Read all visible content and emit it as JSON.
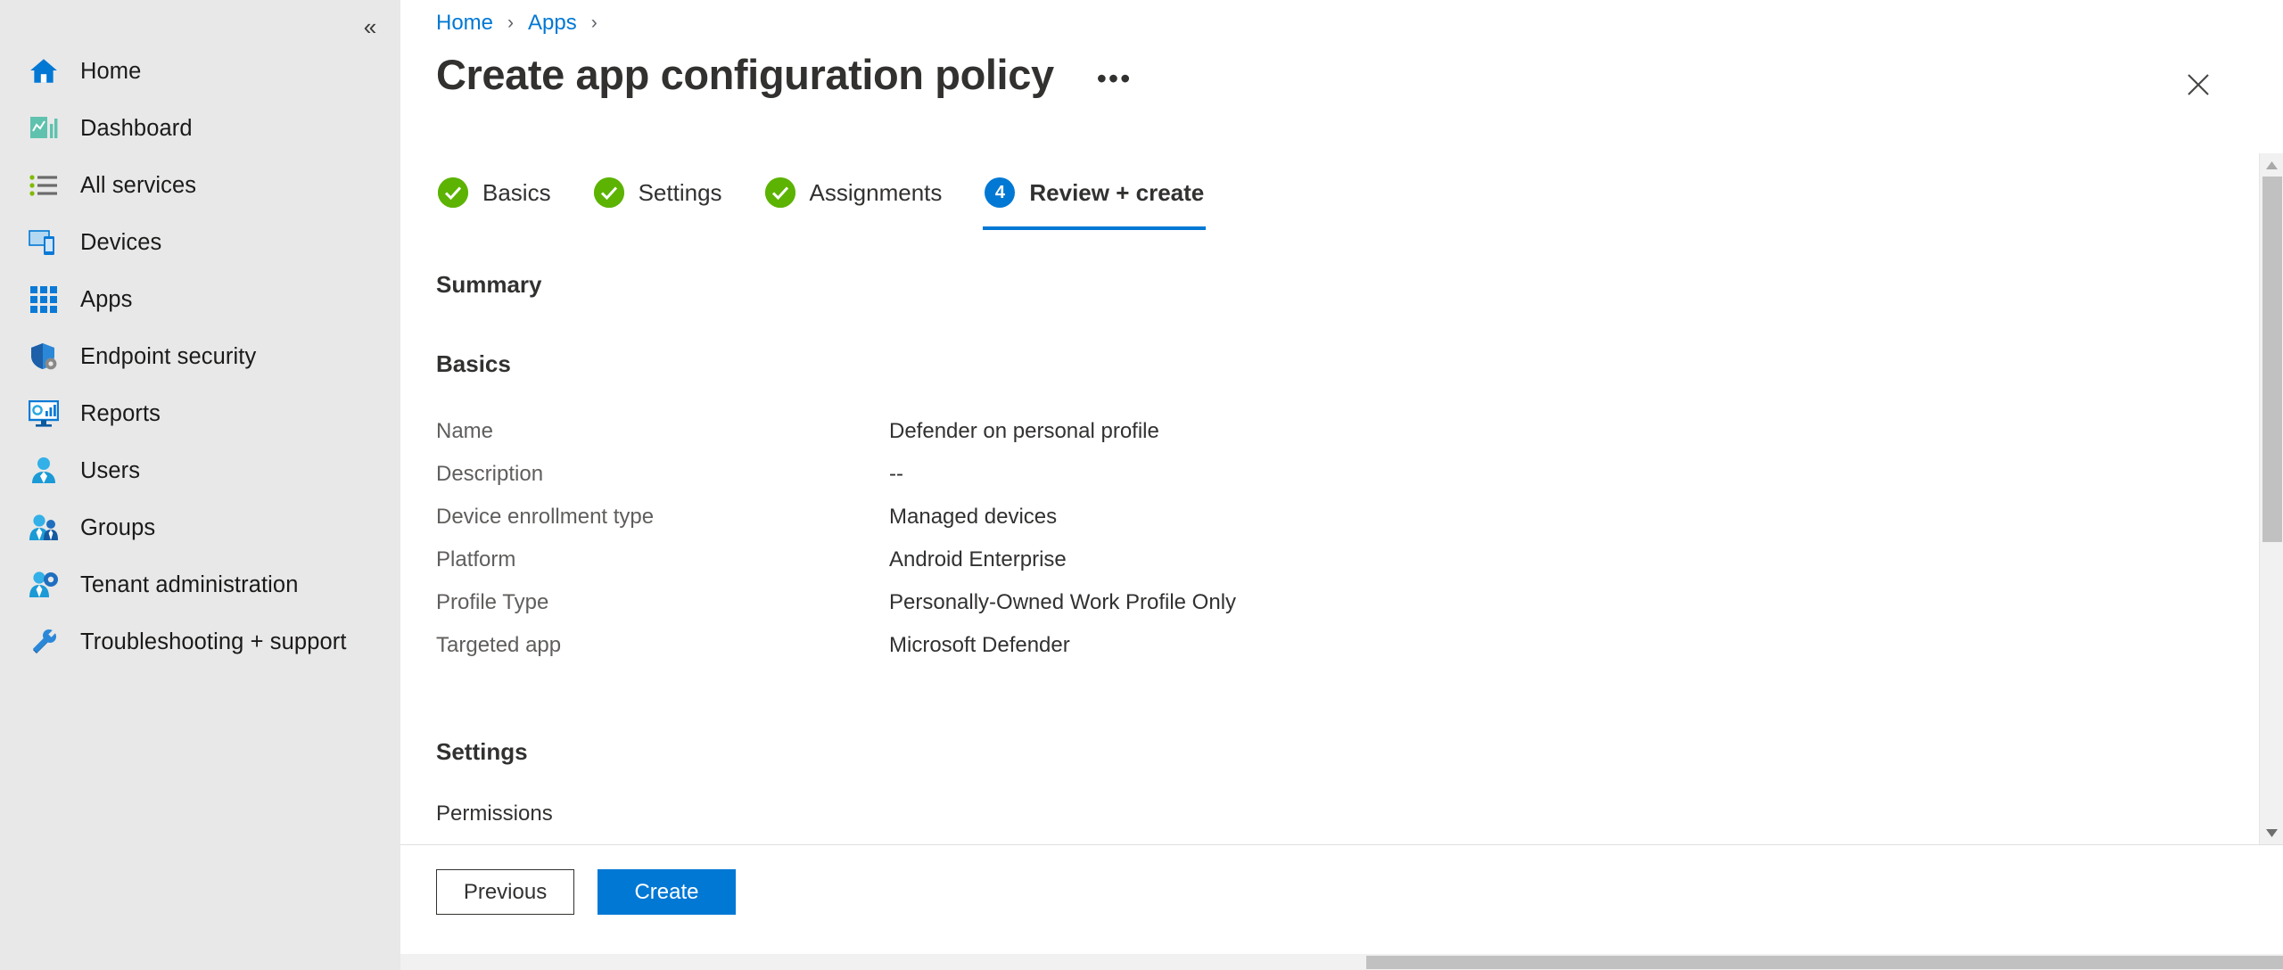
{
  "sidebar": {
    "collapse_icon": "chevron-double-left-icon",
    "items": [
      {
        "label": "Home",
        "icon": "home-icon"
      },
      {
        "label": "Dashboard",
        "icon": "dashboard-icon"
      },
      {
        "label": "All services",
        "icon": "all-services-icon"
      },
      {
        "label": "Devices",
        "icon": "devices-icon"
      },
      {
        "label": "Apps",
        "icon": "apps-grid-icon"
      },
      {
        "label": "Endpoint security",
        "icon": "shield-gear-icon"
      },
      {
        "label": "Reports",
        "icon": "reports-monitor-icon"
      },
      {
        "label": "Users",
        "icon": "user-icon"
      },
      {
        "label": "Groups",
        "icon": "groups-icon"
      },
      {
        "label": "Tenant administration",
        "icon": "user-gear-icon"
      },
      {
        "label": "Troubleshooting + support",
        "icon": "wrench-screwdriver-icon"
      }
    ]
  },
  "breadcrumb": {
    "items": [
      "Home",
      "Apps"
    ],
    "separator": "›",
    "trailing_separator": "›"
  },
  "header": {
    "title": "Create app configuration policy",
    "ellipsis_label": "•••",
    "close_icon": "close-icon"
  },
  "wizard": {
    "tabs": [
      {
        "label": "Basics",
        "state": "done",
        "badge": "✓"
      },
      {
        "label": "Settings",
        "state": "done",
        "badge": "✓"
      },
      {
        "label": "Assignments",
        "state": "done",
        "badge": "✓"
      },
      {
        "label": "Review + create",
        "state": "current",
        "badge": "4"
      }
    ]
  },
  "summary": {
    "heading": "Summary",
    "basics": {
      "heading": "Basics",
      "rows": [
        {
          "key": "Name",
          "value": "Defender on personal profile"
        },
        {
          "key": "Description",
          "value": "--"
        },
        {
          "key": "Device enrollment type",
          "value": "Managed devices"
        },
        {
          "key": "Platform",
          "value": "Android Enterprise"
        },
        {
          "key": "Profile Type",
          "value": "Personally-Owned Work Profile Only"
        },
        {
          "key": "Targeted app",
          "value": "Microsoft Defender"
        }
      ]
    },
    "settings": {
      "heading": "Settings",
      "permissions_label": "Permissions"
    }
  },
  "footer": {
    "previous_label": "Previous",
    "create_label": "Create"
  },
  "colors": {
    "accent": "#0078d4",
    "success": "#5cb302",
    "sidebar_bg": "#e8e8e8",
    "text_primary": "#323130",
    "text_secondary": "#605e5c",
    "link": "#0078d4"
  },
  "scrollbars": {
    "vertical_up_icon": "triangle-up-icon",
    "vertical_down_icon": "triangle-down-icon"
  }
}
